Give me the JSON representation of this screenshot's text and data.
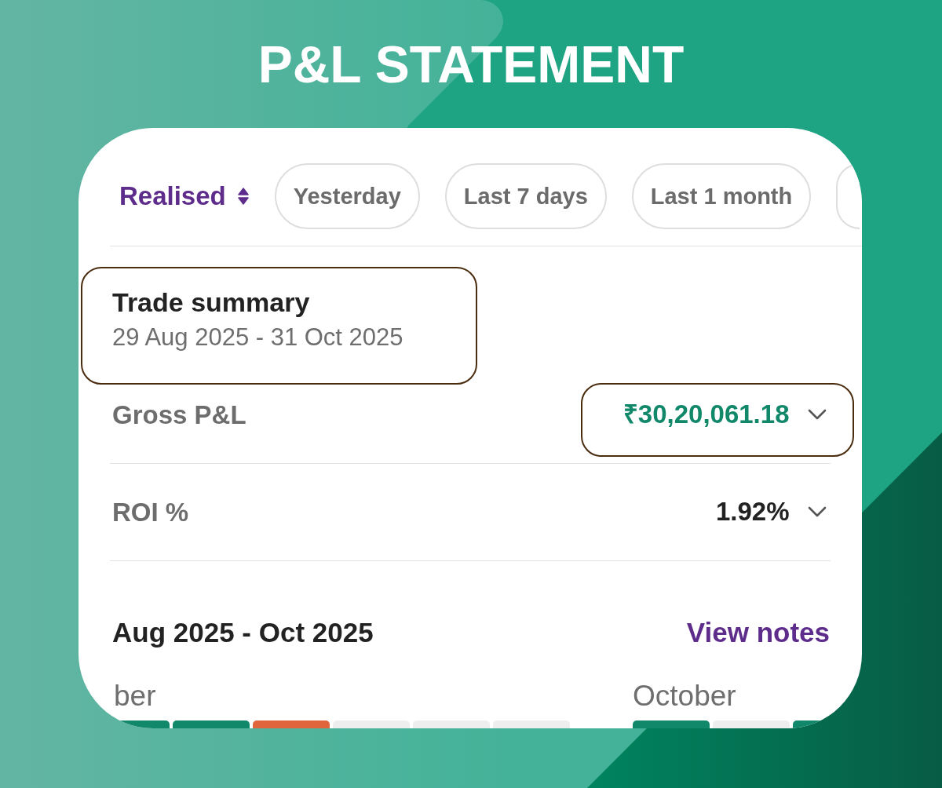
{
  "title": "P&L STATEMENT",
  "filter_bar": {
    "mode": {
      "label": "Realised"
    },
    "chips": [
      {
        "label": "Yesterday",
        "selected": false
      },
      {
        "label": "Last 7 days",
        "selected": false
      },
      {
        "label": "Last 1 month",
        "selected": false
      },
      {
        "selected": false
      }
    ]
  },
  "trade_summary": {
    "title": "Trade summary",
    "date_range": "29 Aug 2025 - 31 Oct 2025",
    "highlighted": true
  },
  "metrics": [
    {
      "label": "Gross P&L",
      "value": "₹30,20,061.18",
      "kind": "profit",
      "highlighted": true,
      "expanded": false
    },
    {
      "label": "ROI %",
      "value": "1.92%",
      "kind": "plain",
      "highlighted": false,
      "expanded": false
    }
  ],
  "calendar": {
    "period": "Aug 2025 - Oct 2025",
    "notes_link": "View notes",
    "months": [
      {
        "label": "ber",
        "days": [
          {
            "color": "#12886a"
          },
          {
            "color": "#12886a"
          },
          {
            "color": "#e0643c"
          },
          {
            "color": "#eeeeee"
          },
          {
            "color": "#eeeeee"
          },
          {
            "color": "#eeeeee"
          }
        ]
      },
      {
        "label": "October",
        "days": [
          {
            "color": "#12886a"
          },
          {
            "color": "#eeeeee"
          },
          {
            "color": "#12886a"
          }
        ]
      }
    ]
  }
}
